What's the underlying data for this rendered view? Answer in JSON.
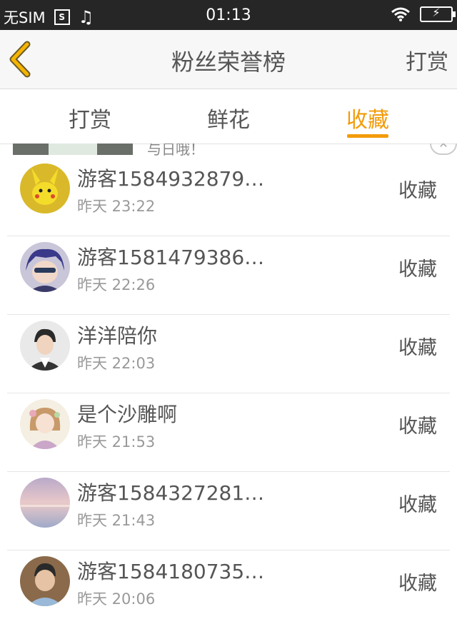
{
  "status_bar": {
    "carrier": "无SIM",
    "sim_glyph": "S",
    "music_glyph": "♫",
    "time": "01:13",
    "wifi_icon": "wifi-icon",
    "battery_icon": "battery-charging-icon",
    "charge_glyph": "⚡"
  },
  "nav": {
    "title": "粉丝荣誉榜",
    "right_action": "打赏",
    "back_icon": "chevron-left-icon",
    "back_color": "#f5b400"
  },
  "tabs": [
    {
      "label": "打赏",
      "active": false
    },
    {
      "label": "鲜花",
      "active": false
    },
    {
      "label": "收藏",
      "active": true
    }
  ],
  "accent_color": "#f29b0a",
  "banner": {
    "text": "与日哦！",
    "close_glyph": "✕"
  },
  "list": [
    {
      "name": "游客1584932879…",
      "time": "昨天 23:22",
      "action": "收藏",
      "avatar": "pikachu-avatar"
    },
    {
      "name": "游客1581479386…",
      "time": "昨天 22:26",
      "action": "收藏",
      "avatar": "anime-avatar"
    },
    {
      "name": "洋洋陪你",
      "time": "昨天 22:03",
      "action": "收藏",
      "avatar": "person-avatar"
    },
    {
      "name": "是个沙雕啊",
      "time": "昨天 21:53",
      "action": "收藏",
      "avatar": "girl-avatar"
    },
    {
      "name": "游客1584327281…",
      "time": "昨天 21:43",
      "action": "收藏",
      "avatar": "sky-avatar"
    },
    {
      "name": "游客1584180735…",
      "time": "昨天 20:06",
      "action": "收藏",
      "avatar": "kid-avatar"
    }
  ]
}
